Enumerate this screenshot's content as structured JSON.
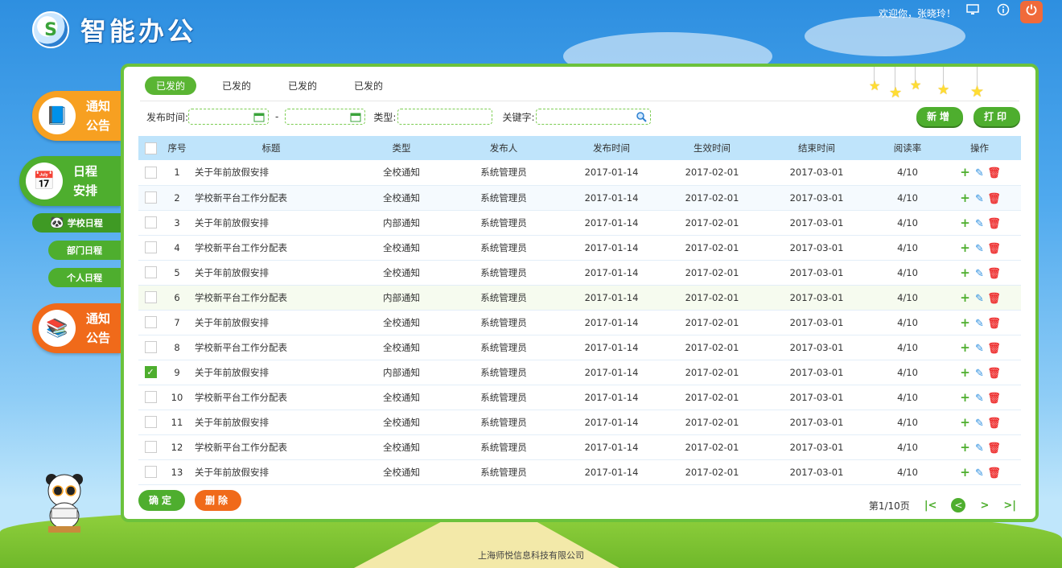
{
  "header": {
    "logo_text": "智能办公",
    "greeting": "欢迎你，张晓玲！",
    "monitor_icon": "monitor-icon",
    "info_icon": "info-icon",
    "power_icon": "power-icon"
  },
  "sidebar": {
    "items": [
      {
        "label_line1": "通知",
        "label_line2": "公告",
        "color": "#f7a021"
      },
      {
        "label_line1": "日程",
        "label_line2": "安排",
        "color": "#4eae2e"
      },
      {
        "label_line1": "通知",
        "label_line2": "公告",
        "color": "#f06a1a"
      }
    ],
    "sub_items": [
      "学校日程",
      "部门日程",
      "个人日程"
    ]
  },
  "tabs": [
    "已发的",
    "已发的",
    "已发的",
    "已发的"
  ],
  "filters": {
    "date_label": "发布时间:",
    "dash": "-",
    "type_label": "类型:",
    "keyword_label": "关键字:"
  },
  "buttons": {
    "add": "新增",
    "print": "打印",
    "confirm": "确定",
    "delete": "删除"
  },
  "table": {
    "headers": [
      "序号",
      "标题",
      "类型",
      "发布人",
      "发布时间",
      "生效时间",
      "结束时间",
      "阅读率",
      "操作"
    ],
    "rows": [
      {
        "n": "1",
        "title": "关于年前放假安排",
        "type": "全校通知",
        "publisher": "系统管理员",
        "pub": "2017-01-14",
        "start": "2017-02-01",
        "end": "2017-03-01",
        "rate": "4/10",
        "checked": false
      },
      {
        "n": "2",
        "title": "学校新平台工作分配表",
        "type": "全校通知",
        "publisher": "系统管理员",
        "pub": "2017-01-14",
        "start": "2017-02-01",
        "end": "2017-03-01",
        "rate": "4/10",
        "checked": false
      },
      {
        "n": "3",
        "title": "关于年前放假安排",
        "type": "内部通知",
        "publisher": "系统管理员",
        "pub": "2017-01-14",
        "start": "2017-02-01",
        "end": "2017-03-01",
        "rate": "4/10",
        "checked": false
      },
      {
        "n": "4",
        "title": "学校新平台工作分配表",
        "type": "全校通知",
        "publisher": "系统管理员",
        "pub": "2017-01-14",
        "start": "2017-02-01",
        "end": "2017-03-01",
        "rate": "4/10",
        "checked": false
      },
      {
        "n": "5",
        "title": "关于年前放假安排",
        "type": "全校通知",
        "publisher": "系统管理员",
        "pub": "2017-01-14",
        "start": "2017-02-01",
        "end": "2017-03-01",
        "rate": "4/10",
        "checked": false
      },
      {
        "n": "6",
        "title": "学校新平台工作分配表",
        "type": "内部通知",
        "publisher": "系统管理员",
        "pub": "2017-01-14",
        "start": "2017-02-01",
        "end": "2017-03-01",
        "rate": "4/10",
        "checked": false
      },
      {
        "n": "7",
        "title": "关于年前放假安排",
        "type": "全校通知",
        "publisher": "系统管理员",
        "pub": "2017-01-14",
        "start": "2017-02-01",
        "end": "2017-03-01",
        "rate": "4/10",
        "checked": false
      },
      {
        "n": "8",
        "title": "学校新平台工作分配表",
        "type": "全校通知",
        "publisher": "系统管理员",
        "pub": "2017-01-14",
        "start": "2017-02-01",
        "end": "2017-03-01",
        "rate": "4/10",
        "checked": false
      },
      {
        "n": "9",
        "title": "关于年前放假安排",
        "type": "内部通知",
        "publisher": "系统管理员",
        "pub": "2017-01-14",
        "start": "2017-02-01",
        "end": "2017-03-01",
        "rate": "4/10",
        "checked": true
      },
      {
        "n": "10",
        "title": "学校新平台工作分配表",
        "type": "全校通知",
        "publisher": "系统管理员",
        "pub": "2017-01-14",
        "start": "2017-02-01",
        "end": "2017-03-01",
        "rate": "4/10",
        "checked": false
      },
      {
        "n": "11",
        "title": "关于年前放假安排",
        "type": "全校通知",
        "publisher": "系统管理员",
        "pub": "2017-01-14",
        "start": "2017-02-01",
        "end": "2017-03-01",
        "rate": "4/10",
        "checked": false
      },
      {
        "n": "12",
        "title": "学校新平台工作分配表",
        "type": "全校通知",
        "publisher": "系统管理员",
        "pub": "2017-01-14",
        "start": "2017-02-01",
        "end": "2017-03-01",
        "rate": "4/10",
        "checked": false
      },
      {
        "n": "13",
        "title": "关于年前放假安排",
        "type": "全校通知",
        "publisher": "系统管理员",
        "pub": "2017-01-14",
        "start": "2017-02-01",
        "end": "2017-03-01",
        "rate": "4/10",
        "checked": false
      }
    ]
  },
  "pager": {
    "text": "第1/10页",
    "first": "|<",
    "prev": "<",
    "next": ">",
    "last": ">|"
  },
  "footer": "上海师悦信息科技有限公司",
  "colors": {
    "accent_green": "#4eae2e",
    "orange": "#f06a1a",
    "header_blue": "#bfe4fb"
  }
}
